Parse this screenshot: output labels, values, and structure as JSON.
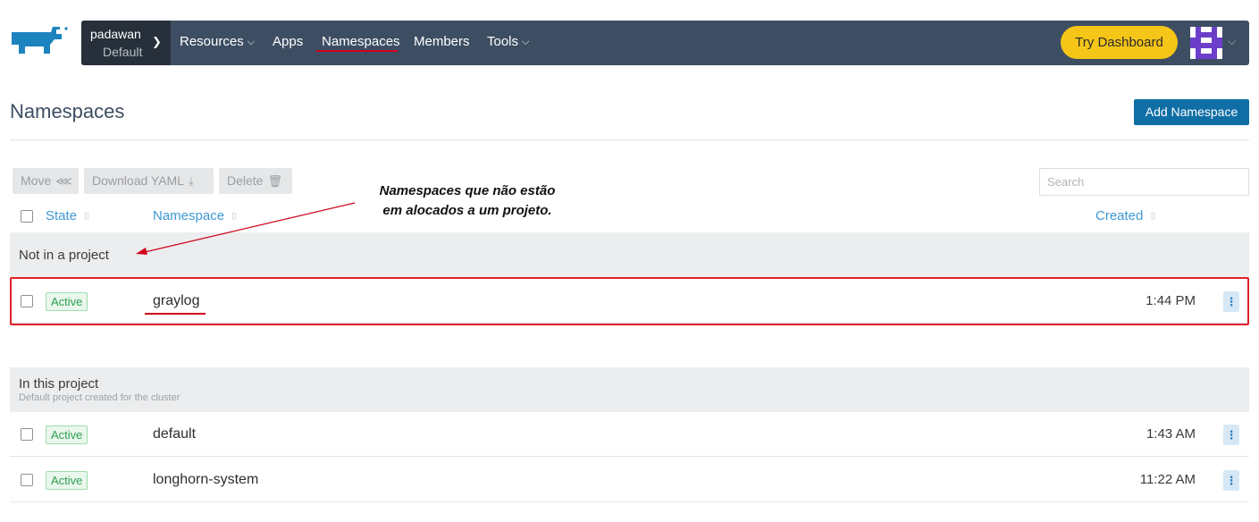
{
  "nav": {
    "cluster_name": "padawan",
    "project_name": "Default",
    "items": [
      {
        "label": "Resources",
        "dropdown": true
      },
      {
        "label": "Apps",
        "dropdown": false
      },
      {
        "label": "Namespaces",
        "dropdown": false,
        "active": true
      },
      {
        "label": "Members",
        "dropdown": false
      },
      {
        "label": "Tools",
        "dropdown": true
      }
    ],
    "try_dashboard": "Try Dashboard"
  },
  "page": {
    "title": "Namespaces",
    "add_button": "Add Namespace"
  },
  "bulk_actions": {
    "move": "Move",
    "download_yaml": "Download YAML",
    "delete": "Delete"
  },
  "search": {
    "placeholder": "Search"
  },
  "table": {
    "columns": {
      "state": "State",
      "namespace": "Namespace",
      "created": "Created"
    },
    "groups": [
      {
        "title": "Not in a project",
        "subtitle": "",
        "rows": [
          {
            "state": "Active",
            "name": "graylog",
            "created": "1:44 PM"
          }
        ]
      },
      {
        "title": "In this project",
        "subtitle": "Default project created for the cluster",
        "rows": [
          {
            "state": "Active",
            "name": "default",
            "created": "1:43 AM"
          },
          {
            "state": "Active",
            "name": "longhorn-system",
            "created": "11:22 AM"
          }
        ]
      }
    ]
  },
  "annotation": {
    "line1": "Namespaces que não estão",
    "line2": "em alocados a um projeto."
  },
  "colors": {
    "nav_bg": "#3d4e63",
    "cluster_bg": "#262f3a",
    "accent_blue": "#0f6ea5",
    "link_blue": "#3d98d3",
    "try_yellow": "#f5c518",
    "annotation_red": "#e0202a",
    "avatar_purple": "#6b3fc9"
  },
  "icons": {
    "logo": "rancher-cow-logo",
    "move": "share-icon",
    "download": "download-icon",
    "delete": "trash-icon",
    "sort": "sort-icon",
    "row_menu": "kebab-menu-icon"
  }
}
